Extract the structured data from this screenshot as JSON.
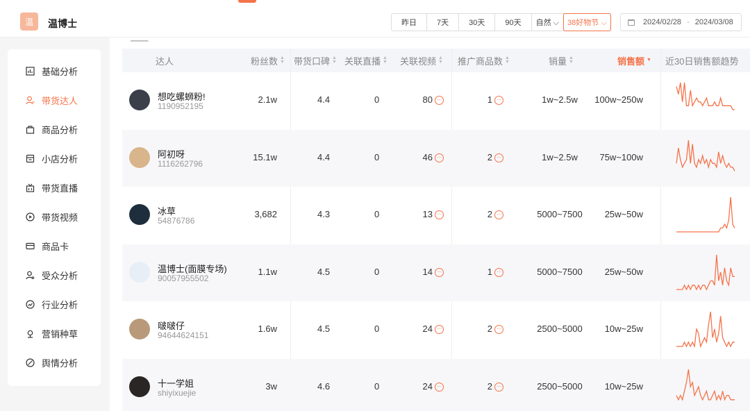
{
  "app": {
    "title": "温博士",
    "logo_text": "温"
  },
  "header": {
    "ranges": [
      "昨日",
      "7天",
      "30天",
      "90天",
      "自然 ⌵",
      "38好物节 ⌵"
    ],
    "selected_range_index": 5,
    "date_start": "2024/02/28",
    "date_sep": "-",
    "date_end": "2024/03/08"
  },
  "sidebar": {
    "items": [
      {
        "label": "基础分析",
        "icon": "bar-chart-icon",
        "active": false
      },
      {
        "label": "带货达人",
        "icon": "user-icon",
        "active": true
      },
      {
        "label": "商品分析",
        "icon": "bag-icon",
        "active": false
      },
      {
        "label": "小店分析",
        "icon": "store-icon",
        "active": false
      },
      {
        "label": "带货直播",
        "icon": "live-icon",
        "active": false
      },
      {
        "label": "带货视频",
        "icon": "play-icon",
        "active": false
      },
      {
        "label": "商品卡",
        "icon": "card-icon",
        "active": false
      },
      {
        "label": "受众分析",
        "icon": "audience-icon",
        "active": false
      },
      {
        "label": "行业分析",
        "icon": "trend-icon",
        "active": false
      },
      {
        "label": "营销种草",
        "icon": "sprout-icon",
        "active": false
      },
      {
        "label": "舆情分析",
        "icon": "opinion-icon",
        "active": false
      }
    ]
  },
  "table": {
    "columns": {
      "talent": "达人",
      "fans": "粉丝数",
      "reputation": "带货口碑",
      "live": "关联直播",
      "video": "关联视频",
      "products": "推广商品数",
      "sales": "销量",
      "revenue": "销售额",
      "trend": "近30日销售额趋势"
    },
    "sorted_column": "revenue",
    "rows": [
      {
        "name": "想吃螺蛳粉!",
        "uid": "1190952195",
        "fans": "2.1w",
        "reputation": "4.4",
        "live": "0",
        "video": "80",
        "products": "1",
        "sales": "1w~2.5w",
        "revenue": "100w~250w",
        "avatar_color": "#3a3f4a",
        "trend": [
          8,
          6,
          9,
          4,
          9,
          3,
          3,
          7,
          3,
          4,
          5,
          4,
          4,
          3,
          4,
          5,
          3,
          3,
          3,
          4,
          3,
          3,
          5,
          3,
          3,
          3,
          3,
          3,
          2,
          2
        ]
      },
      {
        "name": "阿初呀",
        "uid": "1116262796",
        "fans": "15.1w",
        "reputation": "4.4",
        "live": "0",
        "video": "46",
        "products": "2",
        "sales": "1w~2.5w",
        "revenue": "75w~100w",
        "avatar_color": "#d8b58a",
        "trend": [
          3,
          7,
          4,
          2,
          3,
          4,
          9,
          3,
          8,
          3,
          2,
          4,
          3,
          5,
          3,
          4,
          2,
          4,
          3,
          3,
          2,
          6,
          3,
          5,
          3,
          2,
          3,
          2,
          2,
          1
        ]
      },
      {
        "name": "冰草",
        "uid": "54876786",
        "fans": "3,682",
        "reputation": "4.3",
        "live": "0",
        "video": "13",
        "products": "2",
        "sales": "5000~7500",
        "revenue": "25w~50w",
        "avatar_color": "#1f2e3c",
        "trend": [
          0,
          0,
          0,
          0,
          0,
          0,
          0,
          0,
          0,
          0,
          0,
          0,
          0,
          0,
          0,
          0,
          0,
          0,
          0,
          0,
          0,
          0,
          1,
          1,
          2,
          1,
          3,
          9,
          2,
          1
        ]
      },
      {
        "name": "温博士(面膜专场)",
        "uid": "90057955502",
        "fans": "1.1w",
        "reputation": "4.5",
        "live": "0",
        "video": "14",
        "products": "1",
        "sales": "5000~7500",
        "revenue": "25w~50w",
        "avatar_color": "#e8eef5",
        "trend": [
          0,
          0,
          0,
          0,
          1,
          0,
          1,
          0,
          1,
          1,
          0,
          1,
          0,
          1,
          1,
          0,
          1,
          2,
          2,
          1,
          8,
          2,
          4,
          1,
          5,
          2,
          1,
          5,
          3,
          3
        ]
      },
      {
        "name": "啵啵仔",
        "uid": "94644624151",
        "fans": "1.6w",
        "reputation": "4.5",
        "live": "0",
        "video": "24",
        "products": "2",
        "sales": "2500~5000",
        "revenue": "10w~25w",
        "avatar_color": "#b89a7a",
        "trend": [
          0,
          0,
          0,
          0,
          1,
          0,
          1,
          0,
          1,
          0,
          4,
          3,
          0,
          1,
          2,
          1,
          5,
          8,
          2,
          4,
          1,
          3,
          7,
          2,
          1,
          0,
          1,
          0,
          1,
          1
        ]
      },
      {
        "name": "十一学姐",
        "uid": "shiyixuejie",
        "fans": "3w",
        "reputation": "4.6",
        "live": "0",
        "video": "24",
        "products": "2",
        "sales": "2500~5000",
        "revenue": "10w~25w",
        "avatar_color": "#2a2626",
        "trend": [
          2,
          1,
          2,
          1,
          3,
          5,
          8,
          4,
          5,
          2,
          3,
          4,
          2,
          1,
          2,
          3,
          1,
          1,
          2,
          3,
          1,
          2,
          1,
          3,
          1,
          2,
          2,
          1,
          1,
          1
        ]
      }
    ]
  },
  "colors": {
    "accent": "#f5734a",
    "spark": "#f5734a"
  }
}
